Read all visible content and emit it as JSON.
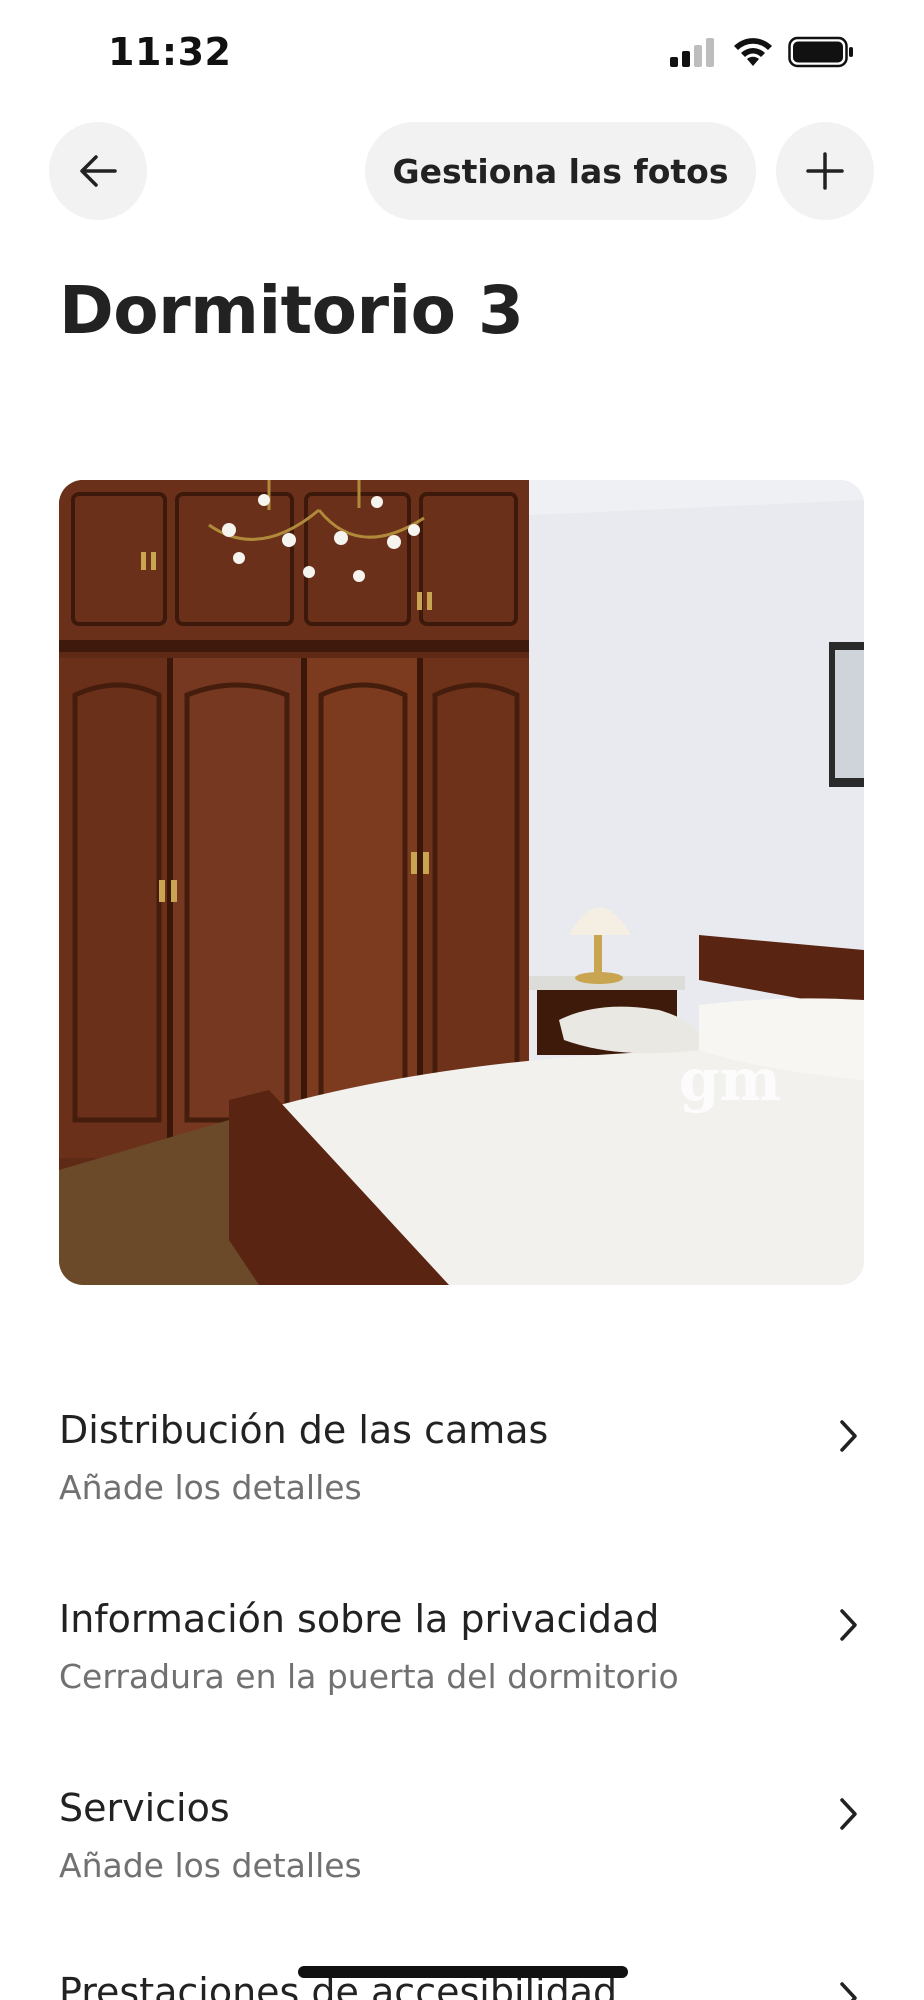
{
  "status_bar": {
    "time": "11:32",
    "icons": [
      "cellular-signal-icon",
      "wifi-icon",
      "battery-icon"
    ]
  },
  "header": {
    "back_icon": "arrow-left-icon",
    "manage_photos_label": "Gestiona las fotos",
    "add_icon": "plus-icon"
  },
  "page": {
    "title": "Dormitorio 3"
  },
  "photo": {
    "watermark": "gm"
  },
  "rows": [
    {
      "title": "Distribución de las camas",
      "subtitle": "Añade los detalles"
    },
    {
      "title": "Información sobre la privacidad",
      "subtitle": "Cerradura en la puerta del dormitorio"
    },
    {
      "title": "Servicios",
      "subtitle": "Añade los detalles"
    },
    {
      "title": "Prestaciones de accesibilidad",
      "subtitle": ""
    }
  ],
  "colors": {
    "text_primary": "#222222",
    "text_secondary": "#717171",
    "button_bg": "#f2f2f2"
  }
}
